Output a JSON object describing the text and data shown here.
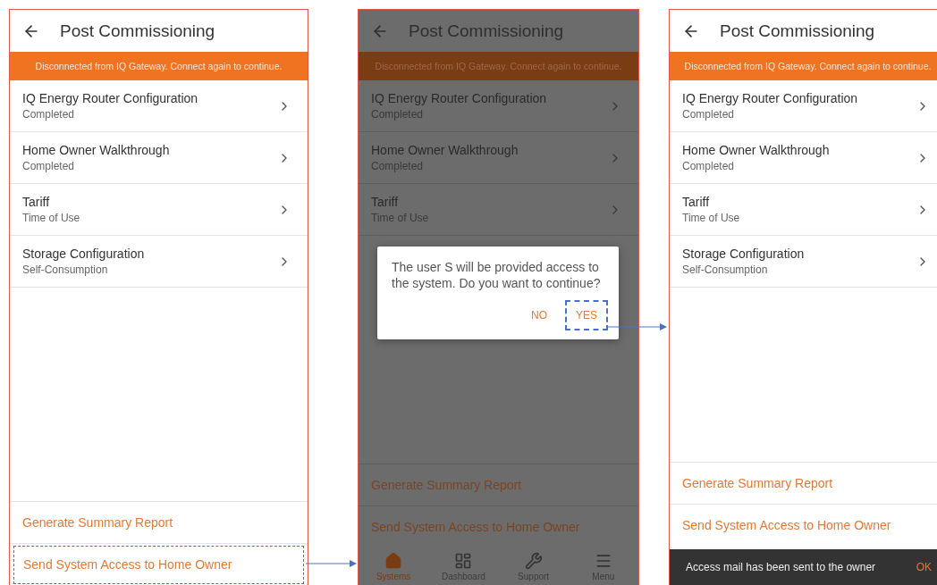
{
  "screens": [
    {
      "kind": "list",
      "dimmed": false,
      "title": "Post Commissioning",
      "banner": "Disconnected from IQ Gateway. Connect again to continue.",
      "items": [
        {
          "title": "IQ Energy Router Configuration",
          "subtitle": "Completed"
        },
        {
          "title": "Home Owner Walkthrough",
          "subtitle": "Completed"
        },
        {
          "title": "Tariff",
          "subtitle": "Time of Use"
        },
        {
          "title": "Storage Configuration",
          "subtitle": "Self-Consumption"
        }
      ],
      "actions": [
        {
          "label": "Generate Summary Report",
          "highlighted": false
        },
        {
          "label": "Send System Access to Home Owner",
          "highlighted": true
        }
      ]
    },
    {
      "kind": "dialog",
      "dimmed": true,
      "title": "Post Commissioning",
      "banner": "Disconnected from IQ Gateway. Connect again to continue.",
      "items": [
        {
          "title": "IQ Energy Router Configuration",
          "subtitle": "Completed"
        },
        {
          "title": "Home Owner Walkthrough",
          "subtitle": "Completed"
        },
        {
          "title": "Tariff",
          "subtitle": "Time of Use"
        }
      ],
      "actions": [
        {
          "label": "Generate Summary Report",
          "highlighted": false
        },
        {
          "label": "Send System Access to Home Owner",
          "highlighted": false
        }
      ],
      "dialog": {
        "message": "The user S will be provided access to the system. Do you want to continue?",
        "buttons": [
          {
            "label": "NO",
            "highlighted": false
          },
          {
            "label": "YES",
            "highlighted": true
          }
        ]
      },
      "tab_bar": [
        {
          "label": "Systems",
          "selected": true
        },
        {
          "label": "Dashboard",
          "selected": false
        },
        {
          "label": "Support",
          "selected": false
        },
        {
          "label": "Menu",
          "selected": false
        }
      ]
    },
    {
      "kind": "snackbar",
      "dimmed": false,
      "title": "Post Commissioning",
      "banner": "Disconnected from IQ Gateway. Connect again to continue.",
      "items": [
        {
          "title": "IQ Energy Router Configuration",
          "subtitle": "Completed"
        },
        {
          "title": "Home Owner Walkthrough",
          "subtitle": "Completed"
        },
        {
          "title": "Tariff",
          "subtitle": "Time of Use"
        },
        {
          "title": "Storage Configuration",
          "subtitle": "Self-Consumption"
        }
      ],
      "actions": [
        {
          "label": "Generate Summary Report",
          "highlighted": false
        },
        {
          "label": "Send System Access to Home Owner",
          "highlighted": false
        }
      ],
      "snackbar": {
        "message": "Access mail has been sent to the owner",
        "action": "OK"
      }
    }
  ]
}
